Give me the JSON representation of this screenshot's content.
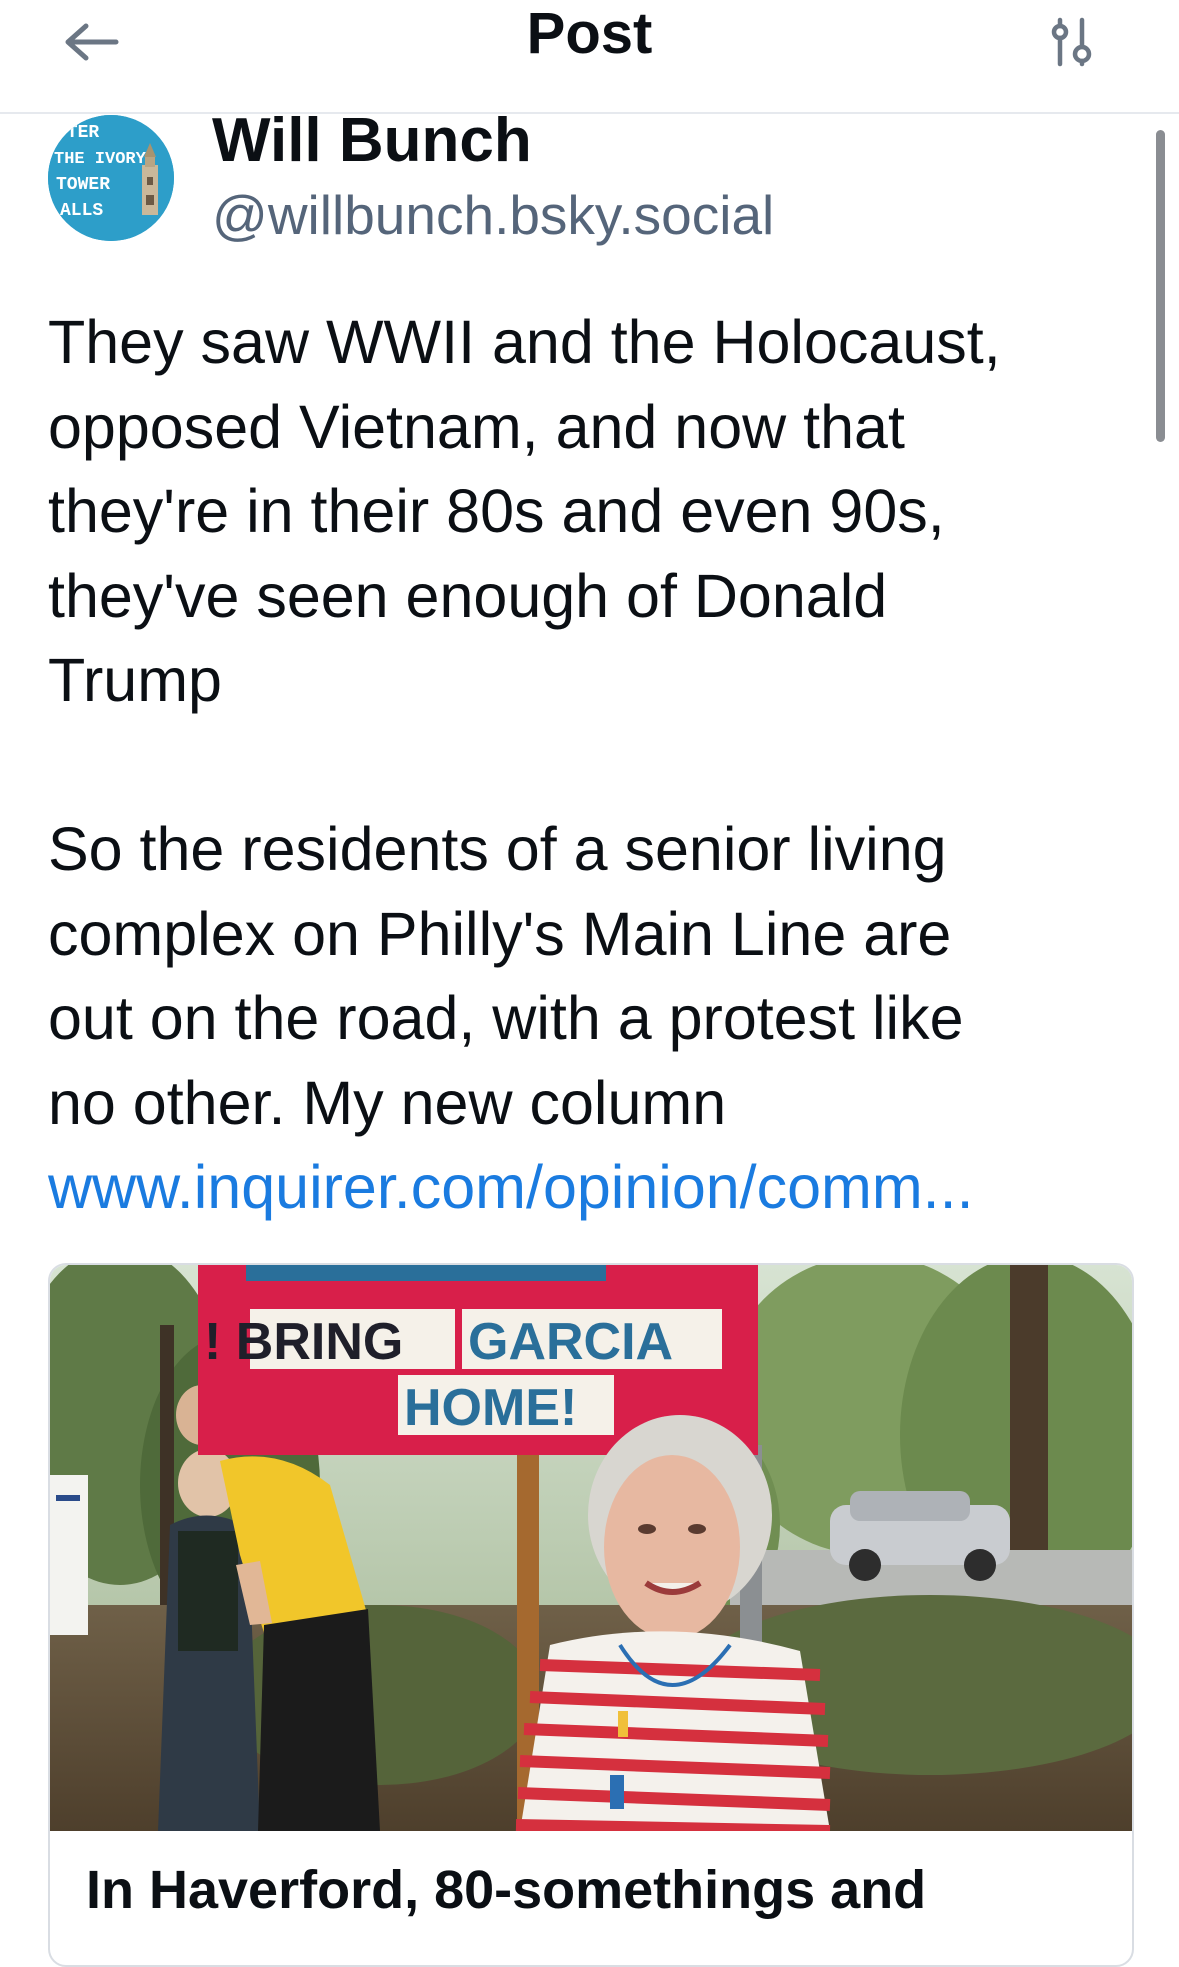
{
  "header": {
    "title": "Post",
    "back_icon": "arrow-left-icon",
    "settings_icon": "sliders-icon"
  },
  "author": {
    "name": "Will Bunch",
    "handle": "@willbunch.bsky.social",
    "avatar_text": {
      "line1": "FTER",
      "line2": "THE IVORY",
      "line3": "TOWER",
      "line4": "ALLS"
    }
  },
  "post": {
    "paragraph1": "They saw WWII and the Holocaust,\nopposed Vietnam, and now that\nthey're in their 80s and even 90s,\nthey've seen enough of Donald\nTrump",
    "paragraph2": "So the residents of a senior living\ncomplex on Philly's Main Line are\nout on the road, with a protest like\nno other. My new column",
    "link_text": "www.inquirer.com/opinion/comm..."
  },
  "card": {
    "sign_line1": "! BRING",
    "sign_line1b": "GARCIA",
    "sign_line2": "HOME!",
    "title": "In Haverford, 80-somethings and"
  },
  "colors": {
    "link": "#1a7be0",
    "handle": "#55657a",
    "sign_red": "#d81f4a",
    "sign_text": "#2a6f9a",
    "avatar_bg": "#2d9ec9"
  }
}
